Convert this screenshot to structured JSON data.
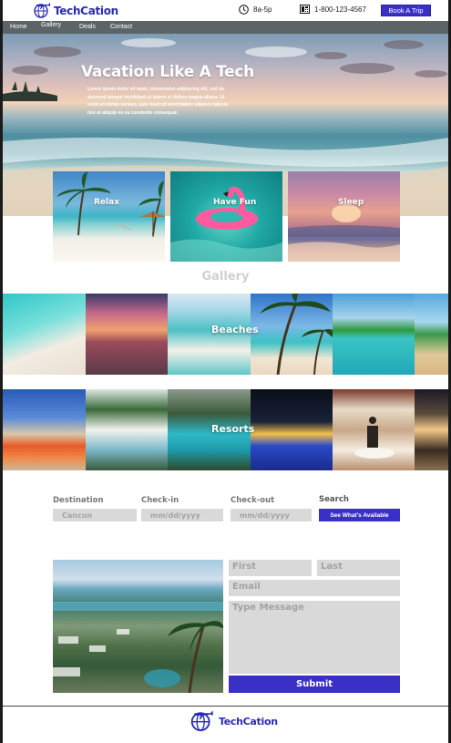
{
  "brand": {
    "name": "TechCation",
    "color": "#2a2ab8"
  },
  "header": {
    "hours": "8a-5p",
    "phone": "1-800-123-4567",
    "book_label": "Book A Trip"
  },
  "nav": {
    "home": "Home",
    "gallery": "Gallery",
    "deals": "Deals",
    "contact": "Contact"
  },
  "hero": {
    "title": "Vacation  Like A Tech",
    "text": "Lorem ipsum dolor sit amet, consectetur adipiscing elit, sed do eiusmod tempor incididunt ut labore et dolore magna aliqua. Ut enim ad minim veniam, quis nostrud exercitation ullamco laboris nisi ut aliquip ex ea commodo consequat."
  },
  "cards": {
    "relax": "Relax",
    "fun": "Have Fun",
    "sleep": "Sleep"
  },
  "gallery": {
    "title": "Gallery",
    "beaches": "Beaches",
    "resorts": "Resorts"
  },
  "booking": {
    "destination_label": "Destination",
    "destination_value": "Cancun",
    "checkin_label": "Check-in",
    "checkin_placeholder": "mm/dd/yyyy",
    "checkout_label": "Check-out",
    "checkout_placeholder": "mm/dd/yyyy",
    "search_label": "Search",
    "search_button": "See What's Available"
  },
  "contact": {
    "first": "First",
    "last": "Last",
    "email": "Email",
    "message": "Type Message",
    "submit": "Submit"
  },
  "colors": {
    "accent": "#3a30c8",
    "nav_bg": "#5c6468",
    "field_bg": "#d9d9d9"
  }
}
